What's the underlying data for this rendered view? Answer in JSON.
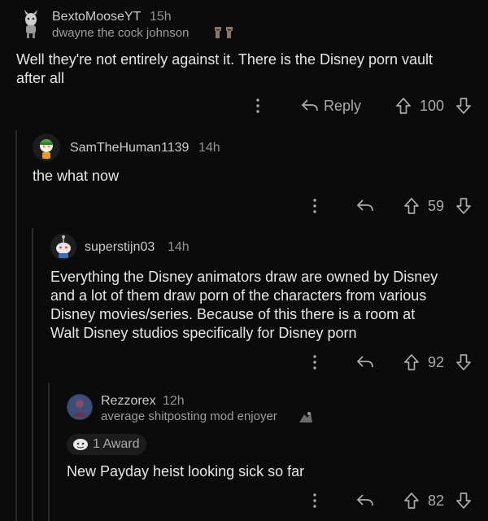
{
  "comments": [
    {
      "username": "BextoMooseYT",
      "time": "15h",
      "flair": "dwayne the cock johnson",
      "body": [
        "Well they're not entirely against it. There is the Disney porn vault",
        "after all"
      ],
      "reply_label": "Reply",
      "votes": "100"
    },
    {
      "username": "SamTheHuman1139",
      "time": "14h",
      "body": [
        "the what now"
      ],
      "votes": "59"
    },
    {
      "username": "superstijn03",
      "time": "14h",
      "body": [
        "Everything the Disney animators draw are owned by Disney",
        "and a lot of them draw porn of the characters from various",
        "Disney movies/series. Because of this there is a room at",
        "Walt Disney studios specifically for Disney porn"
      ],
      "votes": "92"
    },
    {
      "username": "Rezzorex",
      "time": "12h",
      "flair": "average shitposting mod enjoyer",
      "award": "1 Award",
      "body": [
        "New Payday heist looking sick so far"
      ],
      "votes": "82"
    }
  ],
  "icons": {
    "more": "more-vertical-icon",
    "reply": "reply-arrow-icon",
    "upvote": "upvote-arrow-icon",
    "downvote": "downvote-arrow-icon"
  },
  "colors": {
    "background": "#0b0b0b",
    "text": "#e4e6e8",
    "muted": "#8f9396"
  }
}
